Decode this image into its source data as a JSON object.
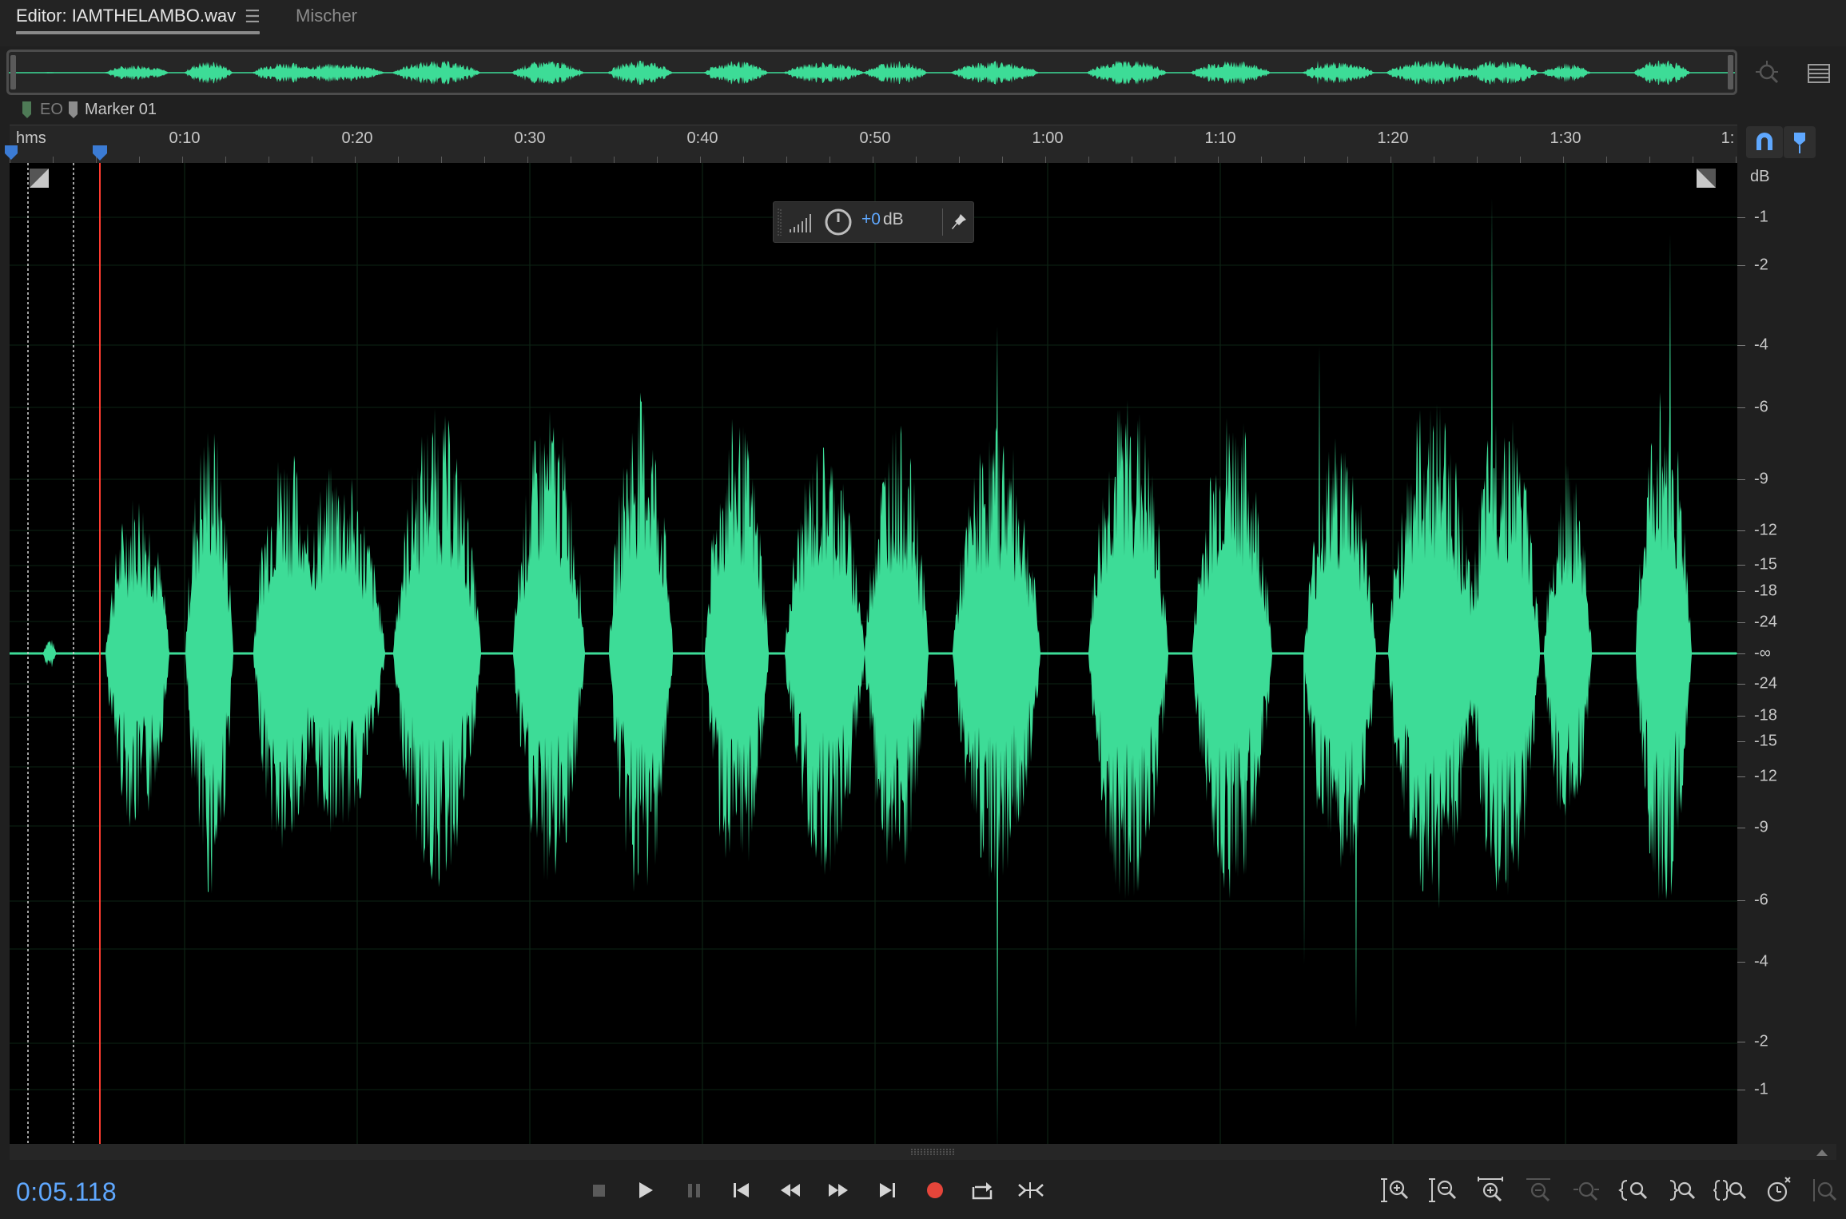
{
  "tabs": {
    "editor_label": "Editor: IAMTHELAMBO.wav",
    "mixer_label": "Mischer"
  },
  "markers": {
    "eo_label": "EO",
    "marker_01_label": "Marker 01"
  },
  "ruler": {
    "units_label": "hms",
    "ticks": [
      "0:10",
      "0:20",
      "0:30",
      "0:40",
      "0:50",
      "1:00",
      "1:10",
      "1:20",
      "1:30",
      "1:"
    ]
  },
  "hud": {
    "value": "+0",
    "unit": "dB"
  },
  "db_scale": {
    "header": "dB",
    "labels": [
      "-1",
      "-2",
      "-4",
      "-6",
      "-9",
      "-12",
      "-15",
      "-18",
      "-24",
      "-∞",
      "-24",
      "-18",
      "-15",
      "-12",
      "-9",
      "-6",
      "-4",
      "-2",
      "-1"
    ]
  },
  "transport": {
    "time": "0:05.118"
  },
  "colors": {
    "waveform": "#3ddc97",
    "accent_blue": "#5fa8ff",
    "playhead": "#ff3b30",
    "record": "#e5453a",
    "background": "#000000"
  },
  "icons": {
    "transport": [
      "stop-icon",
      "play-icon",
      "pause-icon",
      "skip-to-start-icon",
      "rewind-icon",
      "fast-forward-icon",
      "skip-to-end-icon",
      "record-icon",
      "loop-playback-icon",
      "skip-selection-icon"
    ],
    "zoom": [
      "zoom-in-amplitude-icon",
      "zoom-out-amplitude-icon",
      "zoom-in-time-icon",
      "zoom-out-time-icon",
      "zoom-out-full-icon",
      "zoom-in-to-in-point-icon",
      "zoom-in-to-out-point-icon",
      "zoom-to-selection-icon",
      "zoom-to-selected-clips-icon",
      "zoom-reset-icon"
    ]
  }
}
